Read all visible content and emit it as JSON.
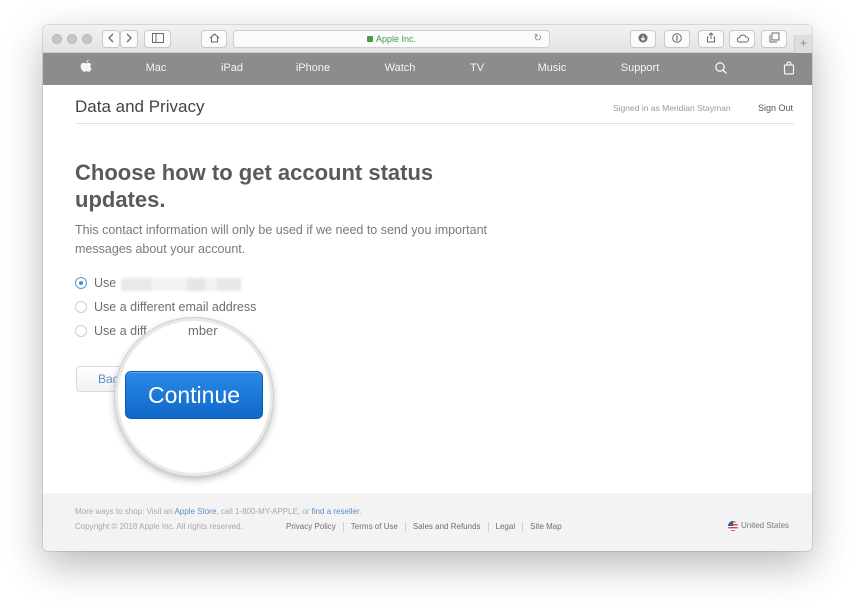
{
  "browser": {
    "address": "Apple Inc.",
    "back_icon": "chevron-left-icon",
    "forward_icon": "chevron-right-icon",
    "new_tab_label": "+"
  },
  "nav": {
    "items": [
      "Mac",
      "iPad",
      "iPhone",
      "Watch",
      "TV",
      "Music",
      "Support"
    ]
  },
  "header": {
    "title": "Data and Privacy",
    "signed_in": "Signed in as Meridian Stayman",
    "sign_out": "Sign Out"
  },
  "main": {
    "heading": "Choose how to get account status updates.",
    "description": "This contact information will only be used if we need to send you important messages about your account.",
    "options": [
      {
        "label": "Use",
        "selected": true
      },
      {
        "label": "Use a different email address",
        "selected": false
      },
      {
        "label": "Use a diff",
        "selected": false
      }
    ],
    "option3_magnified_fragment": "mber",
    "back_button": "Bac",
    "continue_button": "Continue"
  },
  "footer": {
    "shop_prefix": "More ways to shop: Visit an ",
    "apple_store": "Apple Store",
    "shop_middle": ", call 1-800-MY-APPLE, or ",
    "find_reseller": "find a reseller",
    "shop_suffix": ".",
    "copyright": "Copyright © 2018 Apple Inc. All rights reserved.",
    "links": [
      "Privacy Policy",
      "Terms of Use",
      "Sales and Refunds",
      "Legal",
      "Site Map"
    ],
    "region": "United States"
  },
  "colors": {
    "nav_bg": "#8c8c8c",
    "accent": "#1a77d6",
    "link": "#5b8fc7",
    "secure": "#3fa048"
  }
}
